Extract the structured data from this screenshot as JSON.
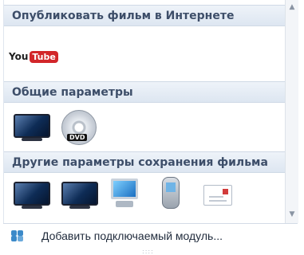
{
  "sections": {
    "publish_online": {
      "title": "Опубликовать фильм в Интернете",
      "items": [
        {
          "icon": "youtube-logo-icon",
          "logo_you": "You",
          "logo_tube": "Tube"
        }
      ]
    },
    "common_settings": {
      "title": "Общие параметры",
      "items": [
        {
          "icon": "monitor-icon"
        },
        {
          "icon": "dvd-disc-icon",
          "badge": "DVD"
        }
      ]
    },
    "other_settings": {
      "title": "Другие параметры сохранения фильма",
      "items": [
        {
          "icon": "monitor-icon"
        },
        {
          "icon": "monitor-icon"
        },
        {
          "icon": "computer-icon"
        },
        {
          "icon": "mobile-phone-icon"
        },
        {
          "icon": "email-icon"
        }
      ]
    }
  },
  "footer": {
    "add_plugin_label": "Добавить подключаемый модуль..."
  },
  "colors": {
    "header_bg": "#dde6f1",
    "header_text": "#3d4e69",
    "youtube_red": "#d2262a"
  }
}
